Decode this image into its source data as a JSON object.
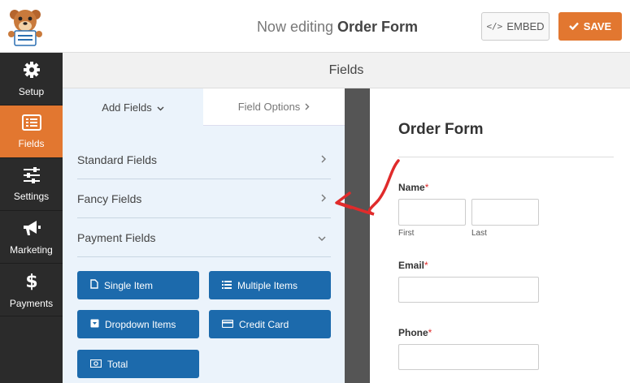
{
  "topbar": {
    "title_prefix": "Now editing",
    "form_name": "Order Form",
    "embed_label": "EMBED",
    "save_label": "SAVE"
  },
  "sidebar": {
    "items": [
      {
        "label": "Setup",
        "icon": "gear-icon"
      },
      {
        "label": "Fields",
        "icon": "fields-icon",
        "active": true
      },
      {
        "label": "Settings",
        "icon": "sliders-icon"
      },
      {
        "label": "Marketing",
        "icon": "megaphone-icon"
      },
      {
        "label": "Payments",
        "icon": "dollar-icon"
      }
    ]
  },
  "header": {
    "title": "Fields"
  },
  "panel": {
    "tabs": [
      {
        "label": "Add Fields",
        "chevron": "⌄"
      },
      {
        "label": "Field Options",
        "chevron": "›"
      }
    ],
    "groups": [
      {
        "label": "Standard Fields",
        "chevron": "›"
      },
      {
        "label": "Fancy Fields",
        "chevron": "›"
      },
      {
        "label": "Payment Fields",
        "chevron": "⌄"
      }
    ],
    "payment_buttons": [
      {
        "label": "Single Item",
        "icon": "file-icon"
      },
      {
        "label": "Multiple Items",
        "icon": "list-icon"
      },
      {
        "label": "Dropdown Items",
        "icon": "dropdown-icon"
      },
      {
        "label": "Credit Card",
        "icon": "credit-card-icon"
      },
      {
        "label": "Total",
        "icon": "money-icon"
      }
    ]
  },
  "preview": {
    "form_title": "Order Form",
    "fields": {
      "name_label": "Name",
      "first_sublabel": "First",
      "last_sublabel": "Last",
      "email_label": "Email",
      "phone_label": "Phone",
      "required_mark": "*"
    }
  },
  "colors": {
    "accent": "#e27730",
    "sidebar_bg": "#2b2b2b",
    "button_blue": "#1c6aac",
    "panel_bg": "#ebf3fb",
    "annotation_red": "#e02b2b"
  }
}
